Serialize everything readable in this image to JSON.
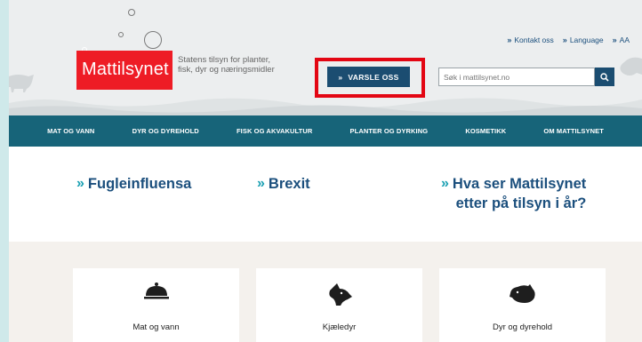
{
  "logo": {
    "text": "Mattilsynet",
    "tagline": "Statens tilsyn for planter, fisk, dyr og næringsmidler",
    "color": "#ee1c25"
  },
  "top_links": [
    {
      "label": "Kontakt oss"
    },
    {
      "label": "Language"
    },
    {
      "label": "AA"
    }
  ],
  "varsle": {
    "label": "VARSLE OSS",
    "highlight_color": "#e30613"
  },
  "search": {
    "placeholder": "Søk i mattilsynet.no",
    "icon": "search-icon"
  },
  "nav": {
    "items": [
      {
        "label": "MAT OG VANN"
      },
      {
        "label": "DYR OG DYREHOLD"
      },
      {
        "label": "FISK OG AKVAKULTUR"
      },
      {
        "label": "PLANTER OG DYRKING"
      },
      {
        "label": "KOSMETIKK"
      },
      {
        "label": "OM MATTILSYNET"
      }
    ],
    "color": "#176479"
  },
  "featured": [
    {
      "label": "Fugleinfluensa"
    },
    {
      "label": "Brexit"
    },
    {
      "line1": "Hva ser Mattilsynet",
      "line2": "etter på tilsyn i år?"
    }
  ],
  "cards": [
    {
      "label": "Mat og vann",
      "icon": "cloche-icon"
    },
    {
      "label": "Kjæledyr",
      "icon": "dog-icon"
    },
    {
      "label": "Dyr og dyrehold",
      "icon": "pig-icon"
    }
  ],
  "colors": {
    "brand_blue": "#1b4d71",
    "link_blue": "#1b4f7d",
    "chevron_teal": "#1ba0b3"
  }
}
